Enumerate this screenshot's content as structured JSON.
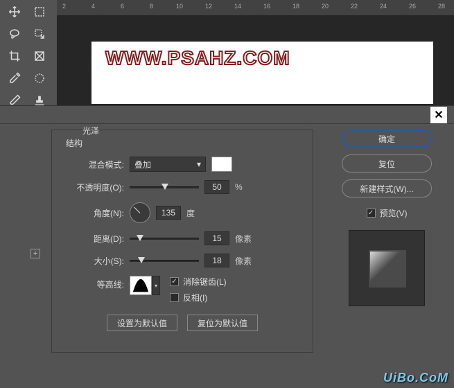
{
  "ruler": {
    "marks": [
      2,
      4,
      6,
      8,
      10,
      12,
      14,
      16,
      18,
      20,
      22,
      24,
      26,
      28
    ]
  },
  "canvas": {
    "watermark": "WWW.PSAHZ.COM"
  },
  "dialog": {
    "title": "光泽",
    "subtitle": "结构",
    "labels": {
      "blend_mode": "混合模式:",
      "opacity": "不透明度(O):",
      "angle": "角度(N):",
      "distance": "距离(D):",
      "size": "大小(S):",
      "contour": "等高线:",
      "antialias": "消除锯齿(L)",
      "invert": "反相(I)",
      "degree_unit": "度",
      "pixel_unit": "像素",
      "percent_unit": "%"
    },
    "values": {
      "blend_mode": "叠加",
      "opacity": "50",
      "angle": "135",
      "distance": "15",
      "size": "18",
      "antialias_checked": true,
      "invert_checked": false
    },
    "buttons": {
      "default": "设置为默认值",
      "reset_default": "复位为默认值",
      "ok": "确定",
      "reset": "复位",
      "new_style": "新建样式(W)...",
      "preview": "预览(V)"
    }
  },
  "footer": {
    "watermark": "UiBo.CoM"
  }
}
